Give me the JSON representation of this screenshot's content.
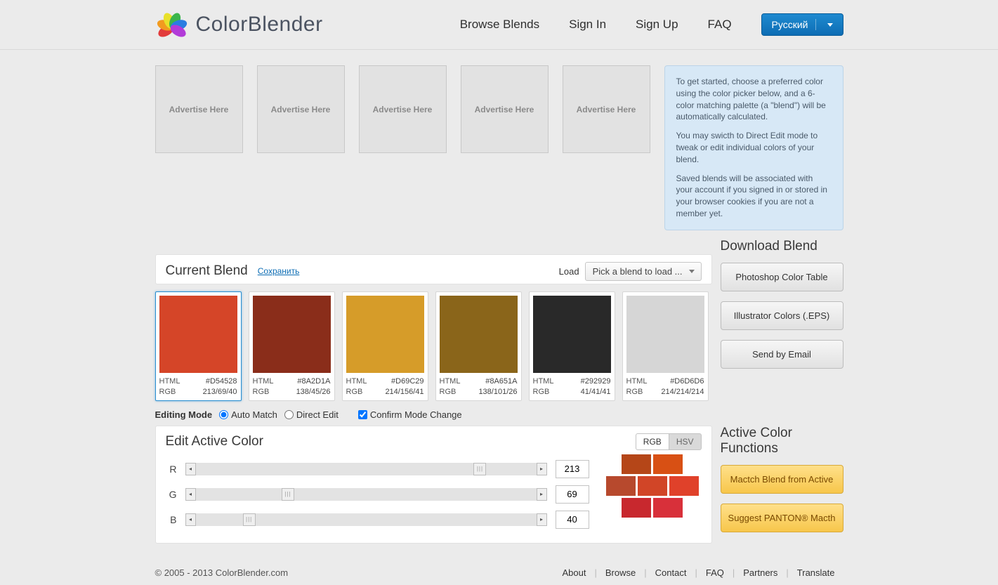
{
  "header": {
    "brand": "ColorBlender",
    "nav": {
      "browse": "Browse Blends",
      "signin": "Sign In",
      "signup": "Sign Up",
      "faq": "FAQ"
    },
    "lang": "Русский"
  },
  "ads": {
    "label": "Advertise Here"
  },
  "intro": {
    "p1": "To get started, choose a preferred color using the color picker below, and a 6-color matching palette (a \"blend\") will be automatically calculated.",
    "p2": "You may swicth to Direct Edit mode to tweak or edit individual colors of your blend.",
    "p3": "Saved blends will be associated with your account if you signed in or stored in your browser cookies if you are not a member yet."
  },
  "blend": {
    "title": "Current Blend",
    "save": "Сохранить",
    "load_label": "Load",
    "load_select": "Pick a blend to load ...",
    "meta_html": "HTML",
    "meta_rgb": "RGB",
    "colors": [
      {
        "hex": "#D54528",
        "rgb": "213/69/40",
        "selected": true
      },
      {
        "hex": "#8A2D1A",
        "rgb": "138/45/26"
      },
      {
        "hex": "#D69C29",
        "rgb": "214/156/41"
      },
      {
        "hex": "#8A651A",
        "rgb": "138/101/26"
      },
      {
        "hex": "#292929",
        "rgb": "41/41/41"
      },
      {
        "hex": "#D6D6D6",
        "rgb": "214/214/214"
      }
    ]
  },
  "mode": {
    "label": "Editing Mode",
    "auto": "Auto Match",
    "direct": "Direct Edit",
    "confirm": "Confirm Mode Change"
  },
  "download": {
    "title": "Download Blend",
    "photoshop": "Photoshop Color Table",
    "illustrator": "Illustrator Colors (.EPS)",
    "email": "Send by Email"
  },
  "edit": {
    "title": "Edit Active Color",
    "rgb": "RGB",
    "hsv": "HSV",
    "r_label": "R",
    "g_label": "G",
    "b_label": "B",
    "r": "213",
    "g": "69",
    "b": "40",
    "r_pct": 83.5,
    "g_pct": 27.1,
    "b_pct": 15.7,
    "variations": {
      "row1": [
        "#b54618",
        "#d85014"
      ],
      "row2": [
        "#b7492d",
        "#d14527",
        "#e0412a"
      ],
      "row3": [
        "#c8282e",
        "#d8303a"
      ]
    }
  },
  "functions": {
    "title": "Active Color Functions",
    "match": "Mactch Blend from Active",
    "pantone": "Suggest PANTON® Macth"
  },
  "footer": {
    "copy": "© 2005 - 2013 ColorBlender.com",
    "about": "About",
    "browse": "Browse",
    "contact": "Contact",
    "faq": "FAQ",
    "partners": "Partners",
    "translate": "Translate"
  }
}
